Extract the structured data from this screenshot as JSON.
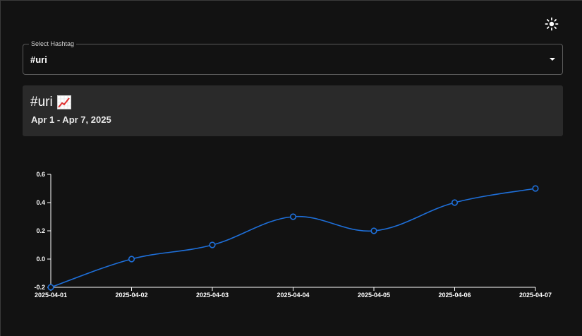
{
  "theme_toggle": {
    "icon": "sun-icon"
  },
  "hashtag_select": {
    "label": "Select Hashtag",
    "value": "#uri",
    "icon": "chevron-down-icon"
  },
  "summary_card": {
    "title": "#uri",
    "trend_icon": "chart-increasing-icon",
    "date_range": "Apr 1 - Apr 7, 2025"
  },
  "colors": {
    "background": "#121212",
    "card": "#2a2a2a",
    "line": "#1e6fd9"
  },
  "chart_data": {
    "type": "line",
    "title": "",
    "xlabel": "",
    "ylabel": "",
    "x": [
      "2025-04-01",
      "2025-04-02",
      "2025-04-03",
      "2025-04-04",
      "2025-04-05",
      "2025-04-06",
      "2025-04-07"
    ],
    "series": [
      {
        "values": [
          -0.2,
          0.0,
          0.1,
          0.3,
          0.2,
          0.4,
          0.5
        ]
      }
    ],
    "ylim": [
      -0.2,
      0.6
    ],
    "yticks": [
      "0.6",
      "0.4",
      "0.2",
      "0.0",
      "-0.2"
    ],
    "grid": false,
    "legend": "none",
    "curve": "smooth"
  }
}
